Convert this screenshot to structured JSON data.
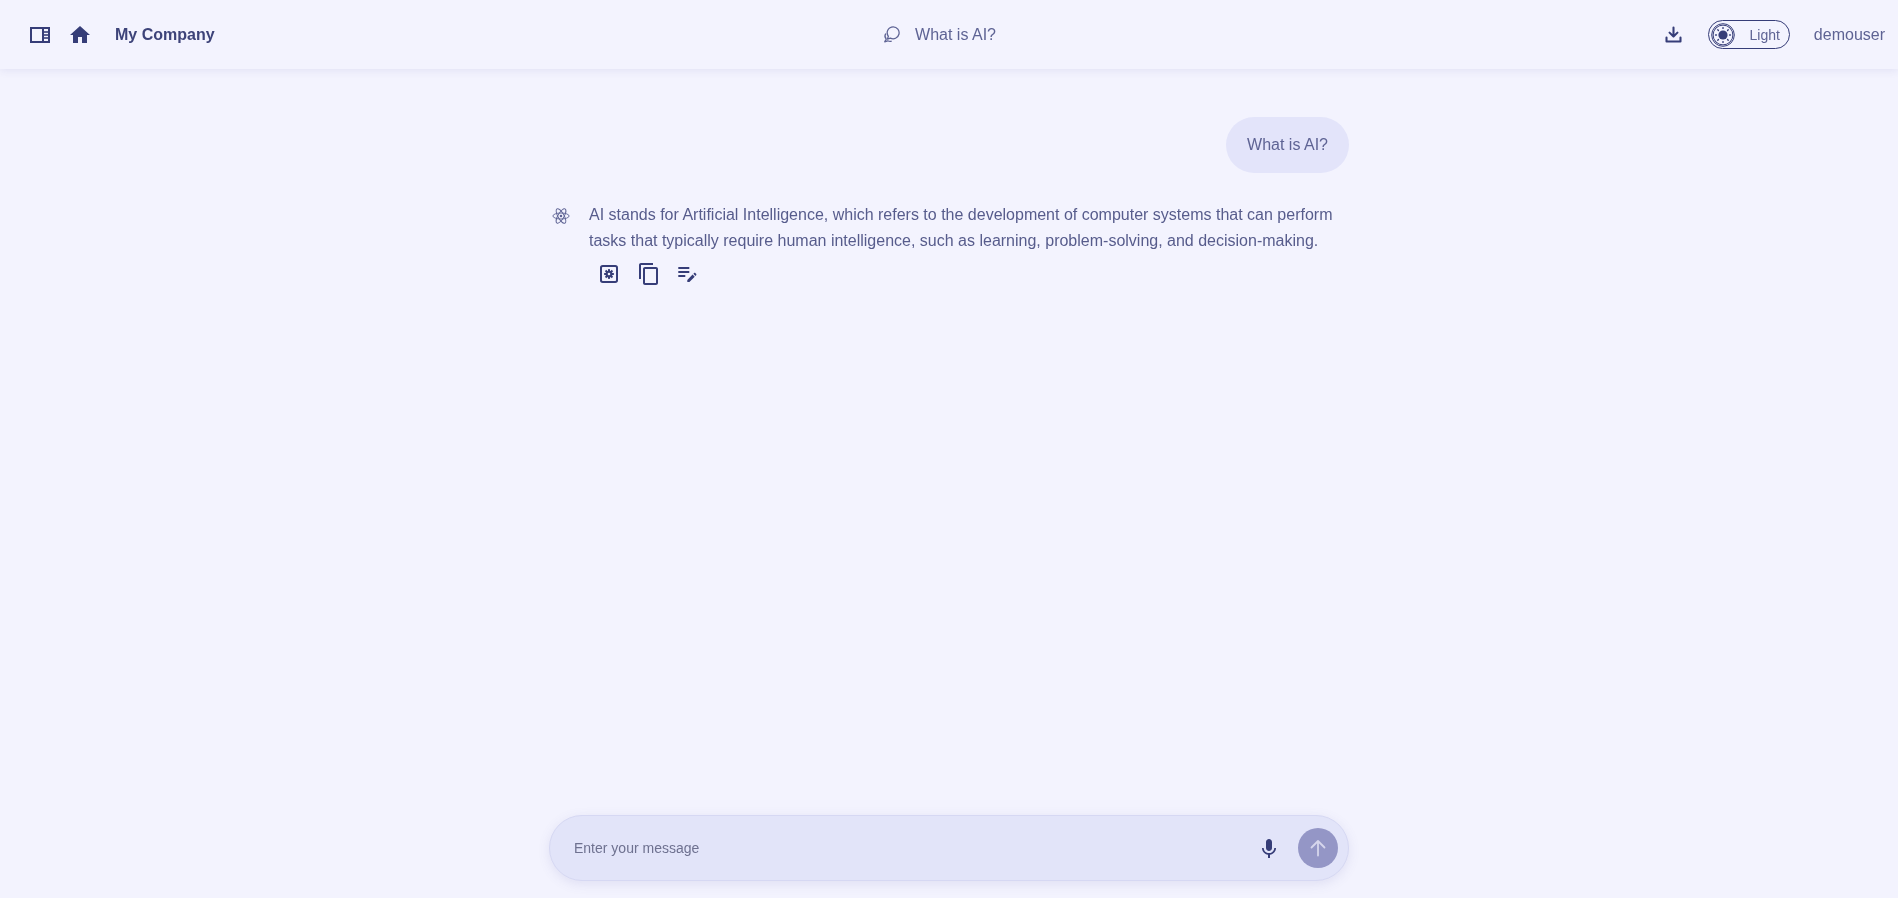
{
  "header": {
    "company": "My Company",
    "chat_title": "What is AI?",
    "theme_toggle": {
      "label": "Light",
      "on": false
    },
    "username": "demouser"
  },
  "messages": [
    {
      "kind": "user",
      "text": "What is AI?"
    },
    {
      "kind": "assistant",
      "text": "AI stands for Artificial Intelligence, which refers to the development of computer systems that can perform tasks that typically require human intelligence, such as learning, problem-solving, and decision-making."
    }
  ],
  "composer": {
    "placeholder": "Enter your message",
    "send_button": {
      "disabled": true
    }
  }
}
